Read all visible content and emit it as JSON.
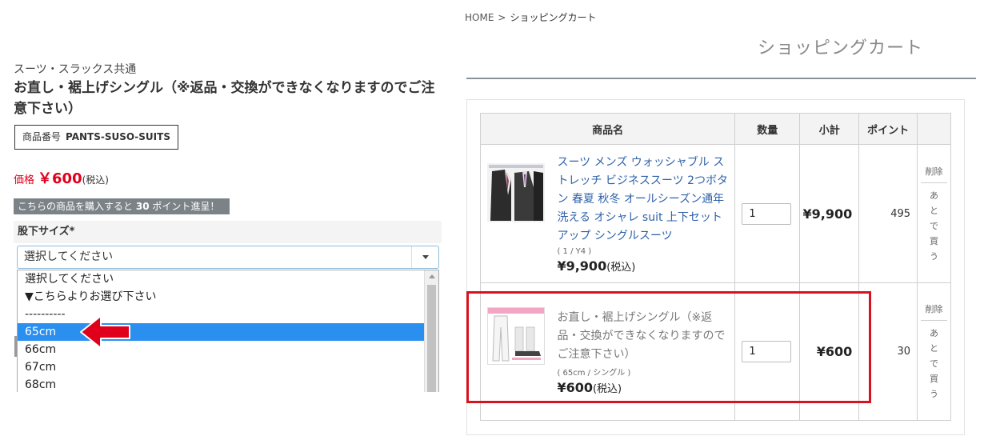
{
  "product": {
    "category": "スーツ・スラックス共通",
    "title": "お直し・裾上げシングル（※返品・交換ができなくなりますのでご注意下さい）",
    "code_label": "商品番号",
    "code": "PANTS-SUSO-SUITS",
    "price_label": "価格",
    "price": "￥600",
    "tax": "(税込)",
    "point_text_pre": "こちらの商品を購入すると",
    "point_value": "30",
    "point_text_post": "ポイント進呈！",
    "size_label": "股下サイズ",
    "required_mark": "*",
    "select_value": "選択してください",
    "options": [
      "選択してください",
      "▼こちらよりお選び下さい",
      "----------",
      "65cm",
      "66cm",
      "67cm",
      "68cm"
    ],
    "selected_index": 3
  },
  "breadcrumb": {
    "home": "HOME",
    "sep": ">",
    "current": "ショッピングカート"
  },
  "cart": {
    "title": "ショッピングカート",
    "headers": {
      "name": "商品名",
      "qty": "数量",
      "subtotal": "小計",
      "point": "ポイント"
    },
    "items": [
      {
        "name": "スーツ メンズ ウォッシャブル ストレッチ ビジネススーツ 2つボタン 春夏 秋冬 オールシーズン通年 洗える オシャレ suit 上下セットアップ シングルスーツ",
        "variant": "( 1 / Y4 )",
        "price": "¥9,900",
        "tax": "(税込)",
        "qty": "1",
        "subtotal": "¥9,900",
        "point": "495",
        "delete": "削除",
        "later": "あとで買う"
      },
      {
        "name": "お直し・裾上げシングル（※返品・交換ができなくなりますのでご注意下さい）",
        "variant": "( 65cm / シングル )",
        "price": "¥600",
        "tax": "(税込)",
        "qty": "1",
        "subtotal": "¥600",
        "point": "30",
        "delete": "削除",
        "later": "あとで買う"
      }
    ]
  },
  "colors": {
    "price_red": "#e0001b",
    "select_blue": "#2b8ff0",
    "highlight_red": "#d8121f",
    "link_blue": "#2f62a8"
  }
}
